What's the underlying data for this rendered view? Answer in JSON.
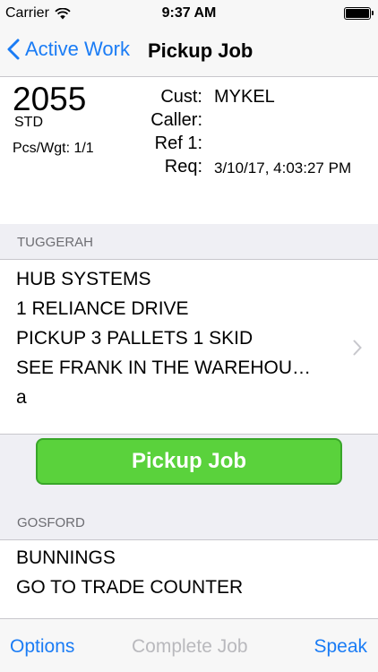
{
  "status_bar": {
    "carrier": "Carrier",
    "time": "9:37 AM",
    "wifi_icon": "wifi-icon",
    "battery_icon": "battery-icon"
  },
  "nav": {
    "back_label": "Active Work",
    "title": "Pickup Job"
  },
  "job": {
    "number": "2055",
    "type": "STD",
    "pcs_wgt": "Pcs/Wgt: 1/1",
    "fields": [
      {
        "label": "Cust:",
        "value": "MYKEL"
      },
      {
        "label": "Caller:",
        "value": ""
      },
      {
        "label": "Ref 1:",
        "value": ""
      },
      {
        "label": "Req:",
        "value": "3/10/17, 4:03:27 PM"
      }
    ]
  },
  "pickup_section": {
    "header": "TUGGERAH",
    "lines": [
      "HUB SYSTEMS",
      "1 RELIANCE DRIVE",
      "PICKUP 3 PALLETS 1 SKID",
      "SEE FRANK IN THE WAREHOU…",
      "a"
    ]
  },
  "pickup_button": {
    "label": "Pickup Job",
    "color": "#5ad23c"
  },
  "delivery_section": {
    "header": "GOSFORD",
    "lines": [
      "BUNNINGS",
      "GO TO TRADE COUNTER"
    ]
  },
  "toolbar": {
    "options": "Options",
    "complete": "Complete Job",
    "speak": "Speak"
  },
  "colors": {
    "accent": "#1a7cf5",
    "disabled": "#b9b9bd"
  }
}
